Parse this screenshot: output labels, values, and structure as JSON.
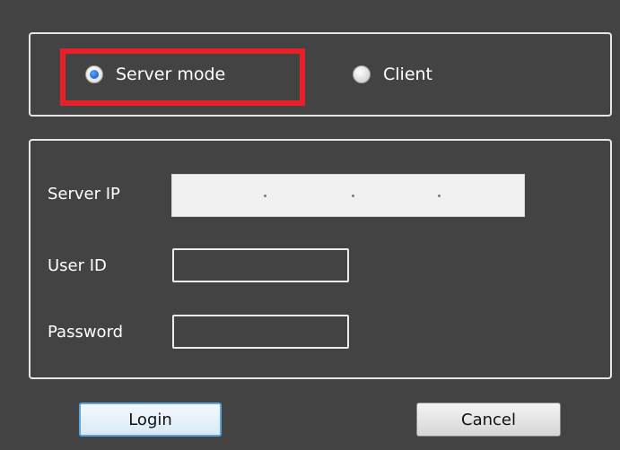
{
  "mode": {
    "server_label": "Server mode",
    "client_label": "Client",
    "selected": "server"
  },
  "form": {
    "server_ip_label": "Server IP",
    "user_id_label": "User ID",
    "password_label": "Password",
    "server_ip_value": "",
    "user_id_value": "",
    "password_value": ""
  },
  "buttons": {
    "login": "Login",
    "cancel": "Cancel"
  },
  "colors": {
    "background": "#434343",
    "highlight": "#e8202a",
    "focus_border": "#5aa7e0"
  }
}
